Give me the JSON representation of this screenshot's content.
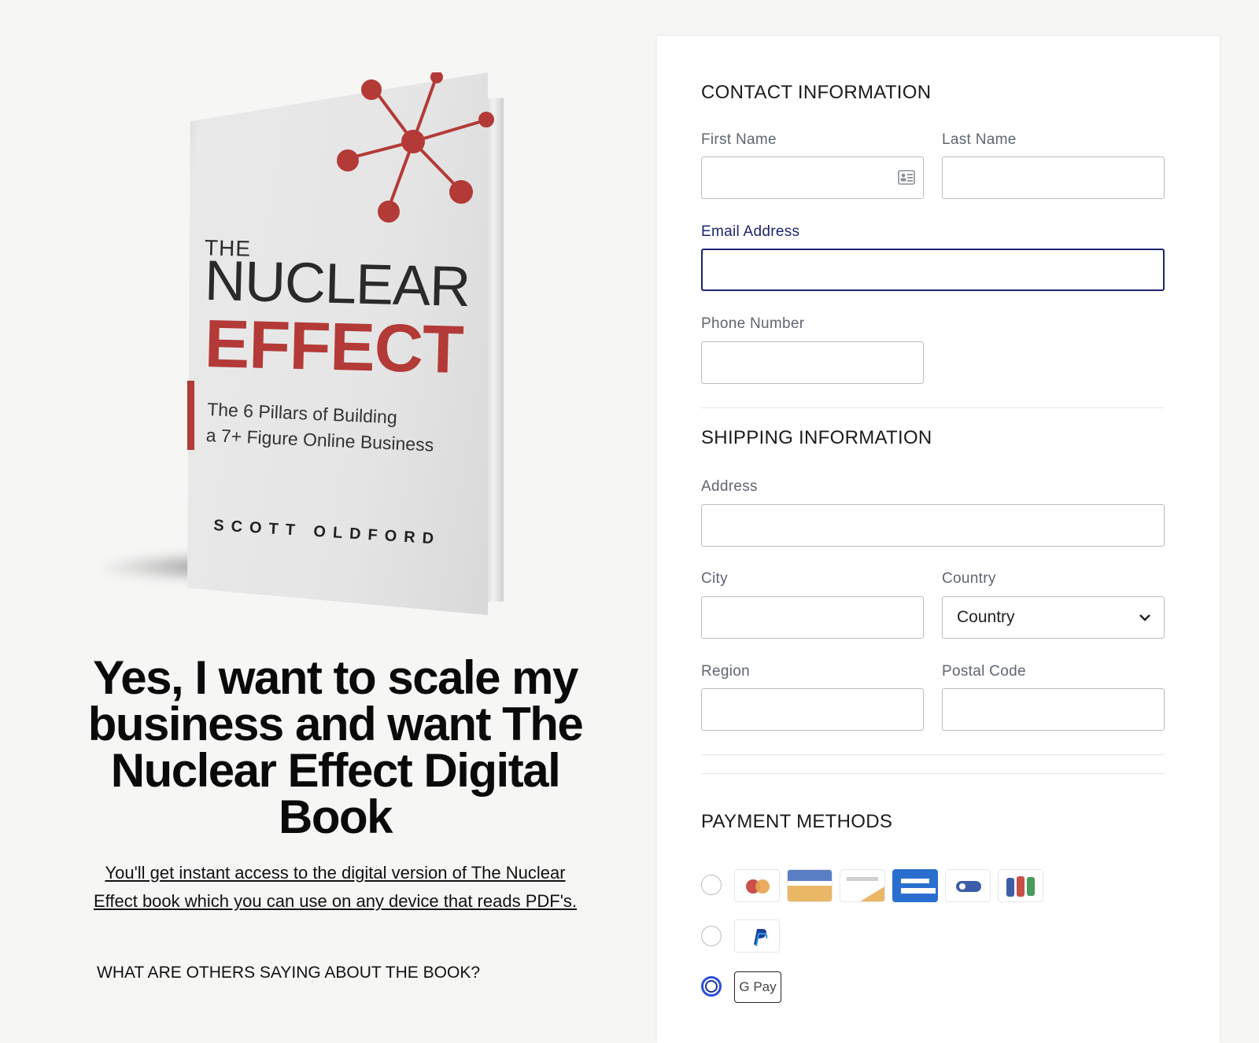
{
  "book": {
    "cover_the": "THE",
    "cover_title_line1": "NUCLEAR",
    "cover_title_line2": "EFFECT",
    "cover_subtitle_line1": "The 6 Pillars of Building",
    "cover_subtitle_line2": "a 7+ Figure Online Business",
    "cover_author": "SCOTT OLDFORD",
    "accent_color": "#b33a37"
  },
  "offer": {
    "headline": "Yes, I want to scale my business and want The Nuclear Effect Digital Book",
    "description": "You'll get instant access to the digital version of The Nuclear Effect book which you can use on any device that reads PDF's.",
    "testimonials_heading": "WHAT ARE OTHERS SAYING ABOUT THE BOOK?"
  },
  "contact": {
    "title": "CONTACT INFORMATION",
    "first_name": {
      "label": "First Name",
      "value": ""
    },
    "last_name": {
      "label": "Last Name",
      "value": ""
    },
    "email": {
      "label": "Email Address",
      "value": ""
    },
    "phone": {
      "label": "Phone Number",
      "value": ""
    }
  },
  "shipping": {
    "title": "SHIPPING INFORMATION",
    "address": {
      "label": "Address",
      "value": ""
    },
    "city": {
      "label": "City",
      "value": ""
    },
    "country": {
      "label": "Country",
      "selected": "Country"
    },
    "region": {
      "label": "Region",
      "value": ""
    },
    "postal": {
      "label": "Postal Code",
      "value": ""
    }
  },
  "payment": {
    "title": "PAYMENT METHODS",
    "options": [
      {
        "name": "card",
        "icons": [
          "mastercard-icon",
          "amex-icon",
          "discover-icon",
          "generic-card-icon",
          "toggle-card-icon",
          "jcb-icon"
        ],
        "selected": false
      },
      {
        "name": "paypal",
        "icons": [
          "paypal-icon"
        ],
        "selected": false
      },
      {
        "name": "google-pay",
        "label": "G Pay",
        "icons": [
          "google-pay-icon"
        ],
        "selected": true
      }
    ],
    "focus_color": "#1c2470"
  }
}
